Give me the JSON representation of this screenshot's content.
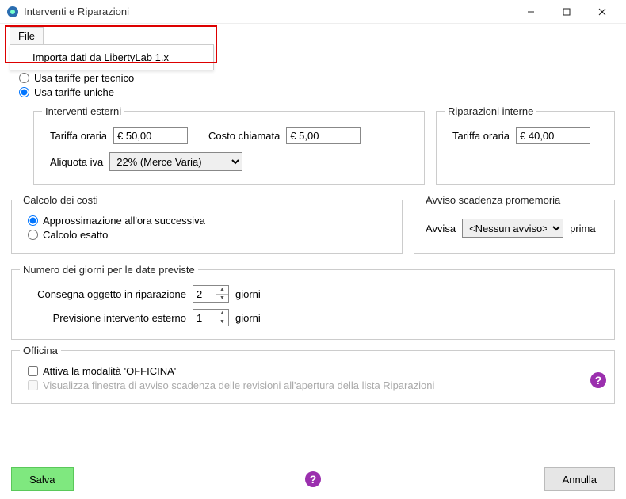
{
  "window": {
    "title": "Interventi e Riparazioni"
  },
  "menu": {
    "file": "File",
    "import": "Importa dati da LibertyLab 1.x"
  },
  "tariffMode": {
    "perTecnico": "Usa tariffe per tecnico",
    "uniche": "Usa tariffe uniche"
  },
  "extern": {
    "legend": "Interventi esterni",
    "tariffa": "Tariffa oraria",
    "tariffaVal": "€ 50,00",
    "costo": "Costo chiamata",
    "costoVal": "€ 5,00",
    "iva": "Aliquota iva",
    "ivaVal": "22% (Merce Varia)"
  },
  "intern": {
    "legend": "Riparazioni interne",
    "tariffa": "Tariffa oraria",
    "tariffaVal": "€ 40,00"
  },
  "calc": {
    "legend": "Calcolo dei costi",
    "approx": "Approssimazione all'ora successiva",
    "esatto": "Calcolo esatto"
  },
  "avviso": {
    "legend": "Avviso scadenza promemoria",
    "avvisa": "Avvisa",
    "sel": "<Nessun avviso>",
    "prima": "prima"
  },
  "giorni": {
    "legend": "Numero dei giorni per le date previste",
    "consegna": "Consegna oggetto in riparazione",
    "consegnaVal": "2",
    "previsione": "Previsione intervento esterno",
    "previsioneVal": "1",
    "unit": "giorni"
  },
  "officina": {
    "legend": "Officina",
    "attiva": "Attiva la modalità 'OFFICINA'",
    "visualizza": "Visualizza finestra di avviso scadenza delle revisioni all'apertura della lista Riparazioni"
  },
  "buttons": {
    "salva": "Salva",
    "annulla": "Annulla"
  },
  "icons": {
    "help": "?"
  }
}
